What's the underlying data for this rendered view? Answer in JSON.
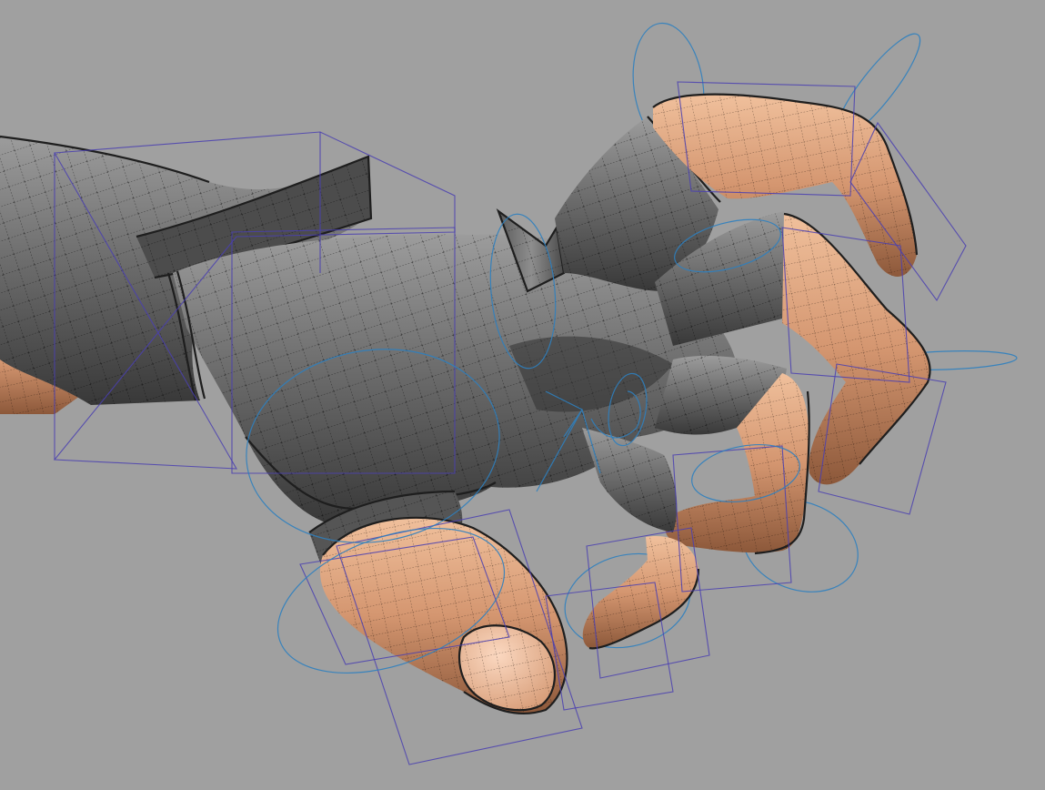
{
  "viewport": {
    "background_color": "#a0a0a0",
    "shading_mode": "smooth-shaded-with-wireframe",
    "colors": {
      "glove": "#6f6f6f",
      "glove_light": "#9a9a9a",
      "glove_dark": "#3e3e3e",
      "skin": "#d59a72",
      "skin_light": "#f2c4a4",
      "skin_dark": "#8d5a3c",
      "control_box": "#4a3fb0",
      "control_ring": "#2e7fbf"
    },
    "objects": [
      "forearm-sleeve",
      "glove-hand",
      "wrist-cuff-spike",
      "index-finger",
      "middle-finger",
      "ring-finger",
      "pinky-finger",
      "thumb",
      "rig-control-boxes",
      "rig-rotation-rings"
    ]
  }
}
